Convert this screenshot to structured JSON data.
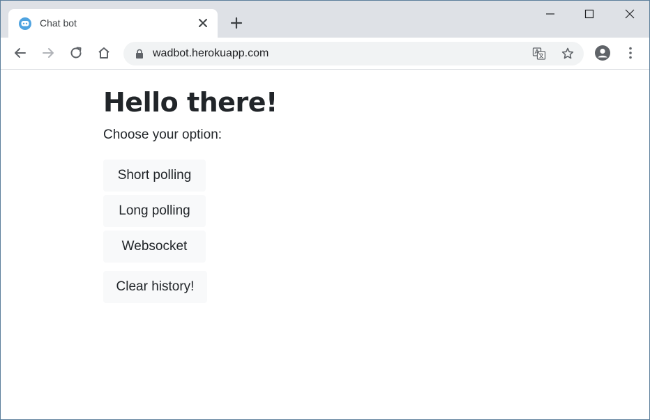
{
  "browser": {
    "tab": {
      "title": "Chat bot",
      "favicon": "chatbot-icon"
    },
    "address_bar": {
      "url": "wadbot.herokuapp.com"
    },
    "icons": {
      "back": "back-arrow-icon",
      "forward": "forward-arrow-icon",
      "reload": "reload-icon",
      "home": "home-icon",
      "lock": "lock-icon",
      "translate": "translate-icon",
      "bookmark": "star-icon",
      "profile": "profile-icon",
      "menu": "kebab-menu-icon",
      "minimize": "minimize-icon",
      "maximize": "maximize-icon",
      "close": "close-icon"
    }
  },
  "page": {
    "heading": "Hello there!",
    "prompt": "Choose your option:",
    "options": [
      {
        "label": "Short polling"
      },
      {
        "label": "Long polling"
      },
      {
        "label": "Websocket"
      }
    ],
    "clear_button": "Clear history!"
  },
  "colors": {
    "tabstrip": "#dee1e6",
    "omnibox": "#f1f3f4",
    "button_bg": "#f8f9fa",
    "text": "#212529",
    "favicon": "#4fa3e0"
  }
}
